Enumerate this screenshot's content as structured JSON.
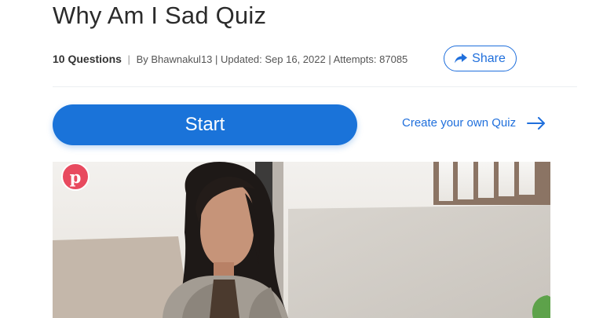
{
  "quiz": {
    "title": "Why Am I Sad Quiz",
    "question_count": "10 Questions",
    "separator": "|",
    "author": "By Bhawnakul13 | Updated: Sep 16, 2022 | Attempts: 87085"
  },
  "actions": {
    "share_label": "Share",
    "start_label": "Start",
    "create_label": "Create your own Quiz"
  },
  "image": {
    "pin_glyph": "p",
    "pin_icon": "pinterest-icon"
  },
  "colors": {
    "accent": "#1a73d9",
    "pinterest": "#e84a5f"
  }
}
